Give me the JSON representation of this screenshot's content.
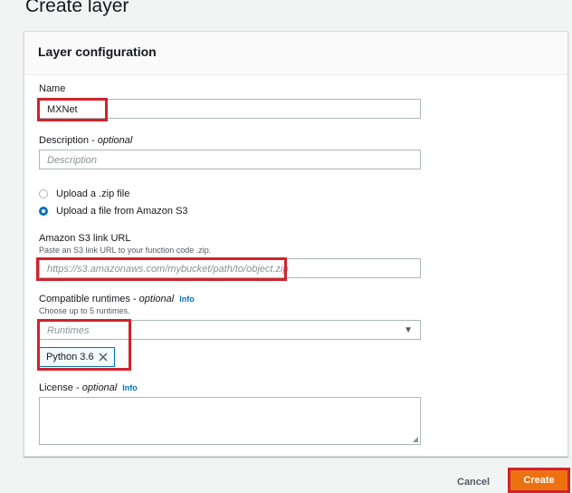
{
  "page": {
    "title": "Create layer"
  },
  "panel": {
    "header": "Layer configuration"
  },
  "name": {
    "label": "Name",
    "value": "MXNet"
  },
  "description": {
    "label": "Description - ",
    "optional": "optional",
    "placeholder": "Description"
  },
  "upload": {
    "options": [
      {
        "label": "Upload a .zip file",
        "selected": false
      },
      {
        "label": "Upload a file from Amazon S3",
        "selected": true
      }
    ]
  },
  "s3": {
    "label": "Amazon S3 link URL",
    "hint": "Paste an S3 link URL to your function code .zip.",
    "placeholder": "https://s3.amazonaws.com/mybucket/path/to/object.zip"
  },
  "runtimes": {
    "label": "Compatible runtimes - ",
    "optional": "optional",
    "info": "Info",
    "hint": "Choose up to 5 runtimes.",
    "placeholder": "Runtimes",
    "selected": [
      "Python 3.6"
    ]
  },
  "license": {
    "label": "License - ",
    "optional": "optional",
    "info": "Info"
  },
  "footer": {
    "cancel": "Cancel",
    "create": "Create"
  },
  "colors": {
    "accent": "#ec7211",
    "link": "#0073bb",
    "highlight": "#d0232a"
  }
}
